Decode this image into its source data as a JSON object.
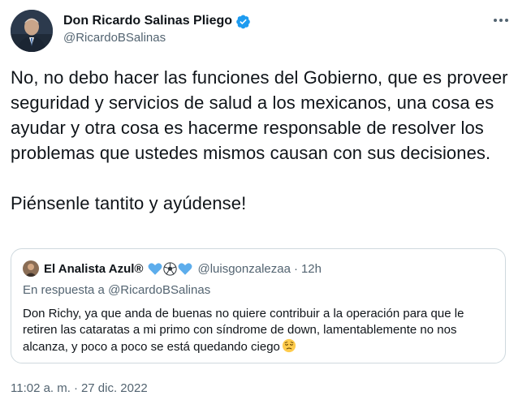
{
  "author": {
    "display_name": "Don Ricardo Salinas Pliego",
    "handle": "@RicardoBSalinas",
    "verified": true
  },
  "menu": {
    "more_icon": "more-horizontal-icon"
  },
  "body": {
    "paragraph_1": "No, no debo hacer las funciones del Gobierno, que es proveer seguridad y servicios de salud a los mexicanos, una cosa es ayudar y otra cosa es hacerme responsable de resolver los problemas que ustedes mismos causan con sus decisiones.",
    "paragraph_2": "Piénsenle tantito y ayúdense!"
  },
  "quoted_tweet": {
    "display_name": "El Analista Azul®",
    "emojis": [
      "blue-heart",
      "soccer-ball",
      "blue-heart"
    ],
    "handle": "@luisgonzalezaa",
    "separator": "·",
    "time": "12h",
    "reply_prefix": "En respuesta a",
    "reply_to": "@RicardoBSalinas",
    "text": "Don Richy, ya que anda de buenas no quiere contribuir a la operación para que le retiren las cataratas a mi primo con síndrome de down, lamentablemente no nos alcanza, y poco a poco se está quedando ciego",
    "trailing_emoji": "pensive-face"
  },
  "footer": {
    "time": "11:02 a. m.",
    "separator": "·",
    "date": "27 dic. 2022"
  },
  "colors": {
    "text": "#0f1419",
    "secondary": "#536471",
    "border": "#cfd9de",
    "verified": "#1d9bf0"
  }
}
